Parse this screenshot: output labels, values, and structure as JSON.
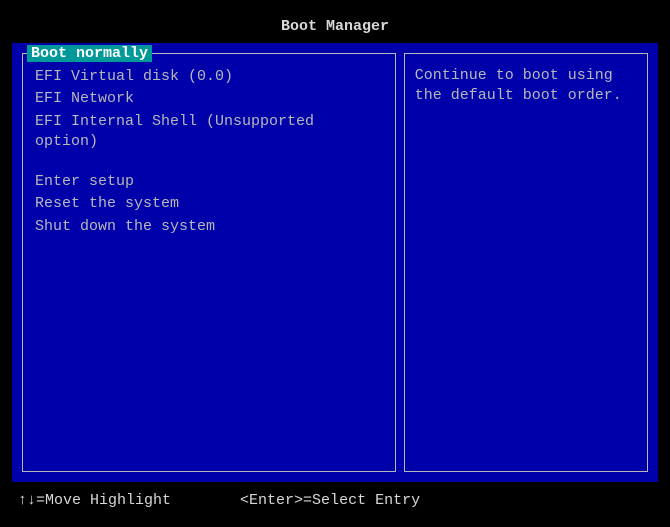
{
  "title": "Boot Manager",
  "menu": {
    "selected_label": "Boot normally",
    "boot_options": [
      "EFI Virtual disk (0.0)",
      "EFI Network",
      "EFI Internal Shell (Unsupported option)"
    ],
    "system_options": [
      "Enter setup",
      "Reset the system",
      "Shut down the system"
    ]
  },
  "description": "Continue to boot using the default boot order.",
  "hints": {
    "move": "↑↓=Move Highlight",
    "select": "<Enter>=Select Entry"
  }
}
